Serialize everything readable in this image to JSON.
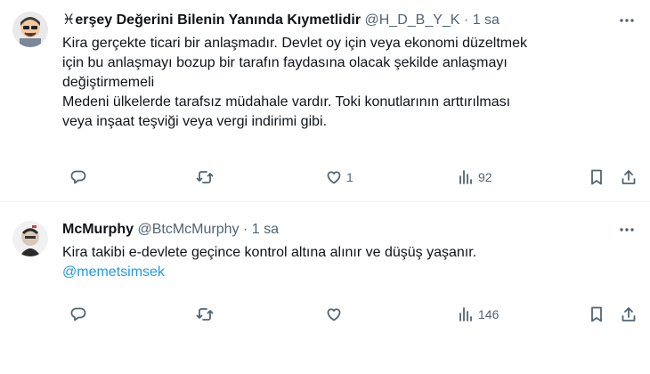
{
  "tweets": [
    {
      "display_name": "♓erşey Değerini Bilenin Yanında Kıymetlidir",
      "handle": "@H_D_B_Y_K",
      "time": "1 sa",
      "lines": [
        "Kira gerçekte ticari bir anlaşmadır. Devlet oy için veya ekonomi düzeltmek",
        "için bu anlaşmayı bozup bir tarafın faydasına olacak şekilde anlaşmayı",
        "değiştirmemeli",
        "Medeni ülkelerde tarafsız müdahale vardır. Toki konutlarının arttırılması",
        "veya inşaat teşviği veya vergi indirimi gibi."
      ],
      "reply_count": "",
      "retweet_count": "",
      "like_count": "1",
      "view_count": "92"
    },
    {
      "display_name": "McMurphy",
      "handle": "@BtcMcMurphy",
      "time": "1 sa",
      "lines": [
        "Kira takibi e-devlete geçince kontrol altına alınır ve düşüş yaşanır."
      ],
      "mention": "@memetsimsek",
      "reply_count": "",
      "retweet_count": "",
      "like_count": "",
      "view_count": "146"
    }
  ],
  "separator": "·",
  "colors": {
    "text": "#0f1419",
    "secondary": "#536471",
    "link": "#1d9bf0",
    "divider": "#eff3f4"
  },
  "icons": [
    "more-icon",
    "reply-icon",
    "retweet-icon",
    "like-icon",
    "views-icon",
    "bookmark-icon",
    "share-icon"
  ]
}
